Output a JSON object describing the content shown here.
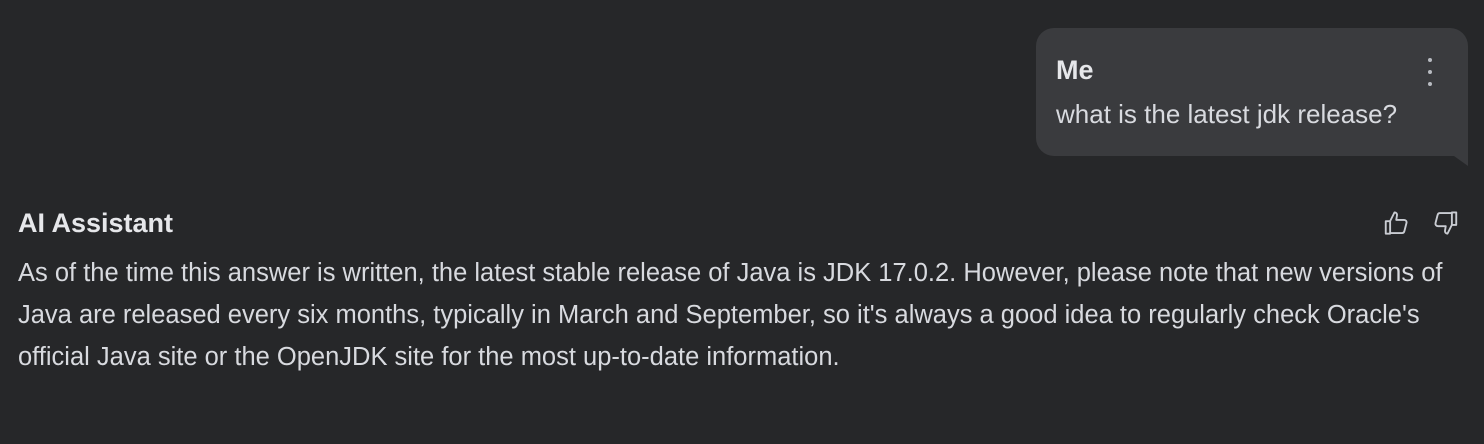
{
  "user_message": {
    "author": "Me",
    "text": "what is the latest jdk release?"
  },
  "assistant_message": {
    "author": "AI Assistant",
    "text": "As of the time this answer is written, the latest stable release of Java is JDK 17.0.2. However, please note that new versions of Java are released every six months, typically in March and September, so it's always a good idea to regularly check Oracle's official Java site or the OpenJDK site for the most up-to-date information."
  },
  "icons": {
    "more": "more-vertical-icon",
    "like": "thumbs-up-icon",
    "dislike": "thumbs-down-icon"
  },
  "colors": {
    "background": "#262729",
    "bubble": "#3a3b3e",
    "text": "#d8dadf"
  }
}
